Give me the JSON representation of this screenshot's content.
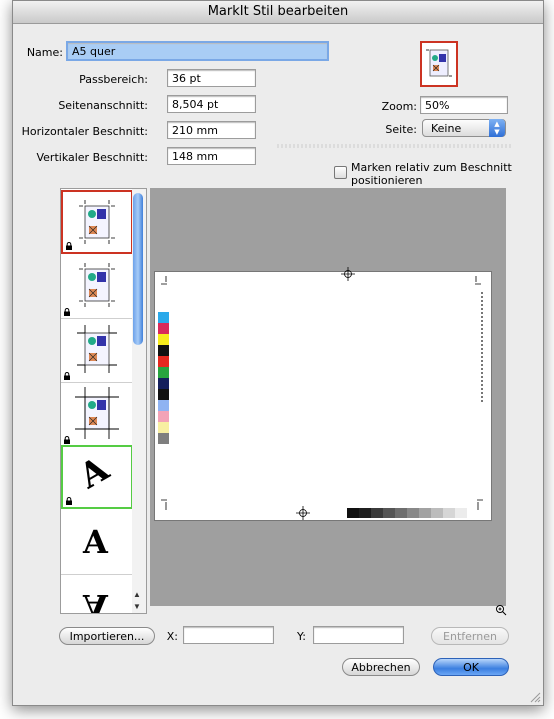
{
  "dialog": {
    "title": "MarkIt Stil bearbeiten"
  },
  "form": {
    "name_label": "Name:",
    "name_value": "A5 quer",
    "fields": [
      {
        "label": "Passbereich:",
        "value": "36 pt"
      },
      {
        "label": "Seitenanschnitt:",
        "value": "8,504 pt"
      },
      {
        "label": "Horizontaler Beschnitt:",
        "value": "210 mm"
      },
      {
        "label": "Vertikaler Beschnitt:",
        "value": "148 mm"
      }
    ]
  },
  "view": {
    "zoom_label": "Zoom:",
    "zoom_value": "50%",
    "page_label": "Seite:",
    "page_value": "Keine",
    "marks_relative_line1": "Marken relativ zum Beschnitt",
    "marks_relative_line2": "positionieren",
    "marks_relative_checked": false
  },
  "mark_list": [
    {
      "name": "crop-marks-style-1",
      "selected": "red",
      "locked": true,
      "kind": "icon"
    },
    {
      "name": "crop-marks-style-2",
      "selected": "",
      "locked": true,
      "kind": "icon"
    },
    {
      "name": "crop-marks-style-3",
      "selected": "",
      "locked": true,
      "kind": "icon"
    },
    {
      "name": "crop-marks-style-4",
      "selected": "",
      "locked": true,
      "kind": "icon"
    },
    {
      "name": "text-mark-rotated",
      "selected": "green",
      "locked": true,
      "kind": "text",
      "glyph": "A"
    },
    {
      "name": "text-mark",
      "selected": "",
      "locked": false,
      "kind": "text",
      "glyph": "A"
    },
    {
      "name": "text-mark-flipped",
      "selected": "",
      "locked": false,
      "kind": "text",
      "glyph": "A"
    }
  ],
  "color_bar": [
    "#2aa9ea",
    "#d92a5a",
    "#f7ec1c",
    "#111111",
    "#e5281f",
    "#27a43f",
    "#141f5c",
    "#111111",
    "#8fb3f2",
    "#f3a3b7",
    "#f8efa2",
    "#7f7f7f"
  ],
  "gray_bar": [
    "#111111",
    "#1f1f1f",
    "#3a3a3a",
    "#555555",
    "#6e6e6e",
    "#888888",
    "#a2a2a2",
    "#bcbcbc",
    "#d6d6d6",
    "#ececec"
  ],
  "coords": {
    "x_label": "X:",
    "y_label": "Y:",
    "x_value": "",
    "y_value": ""
  },
  "buttons": {
    "import": "Importieren...",
    "remove": "Entfernen",
    "cancel": "Abbrechen",
    "ok": "OK"
  }
}
